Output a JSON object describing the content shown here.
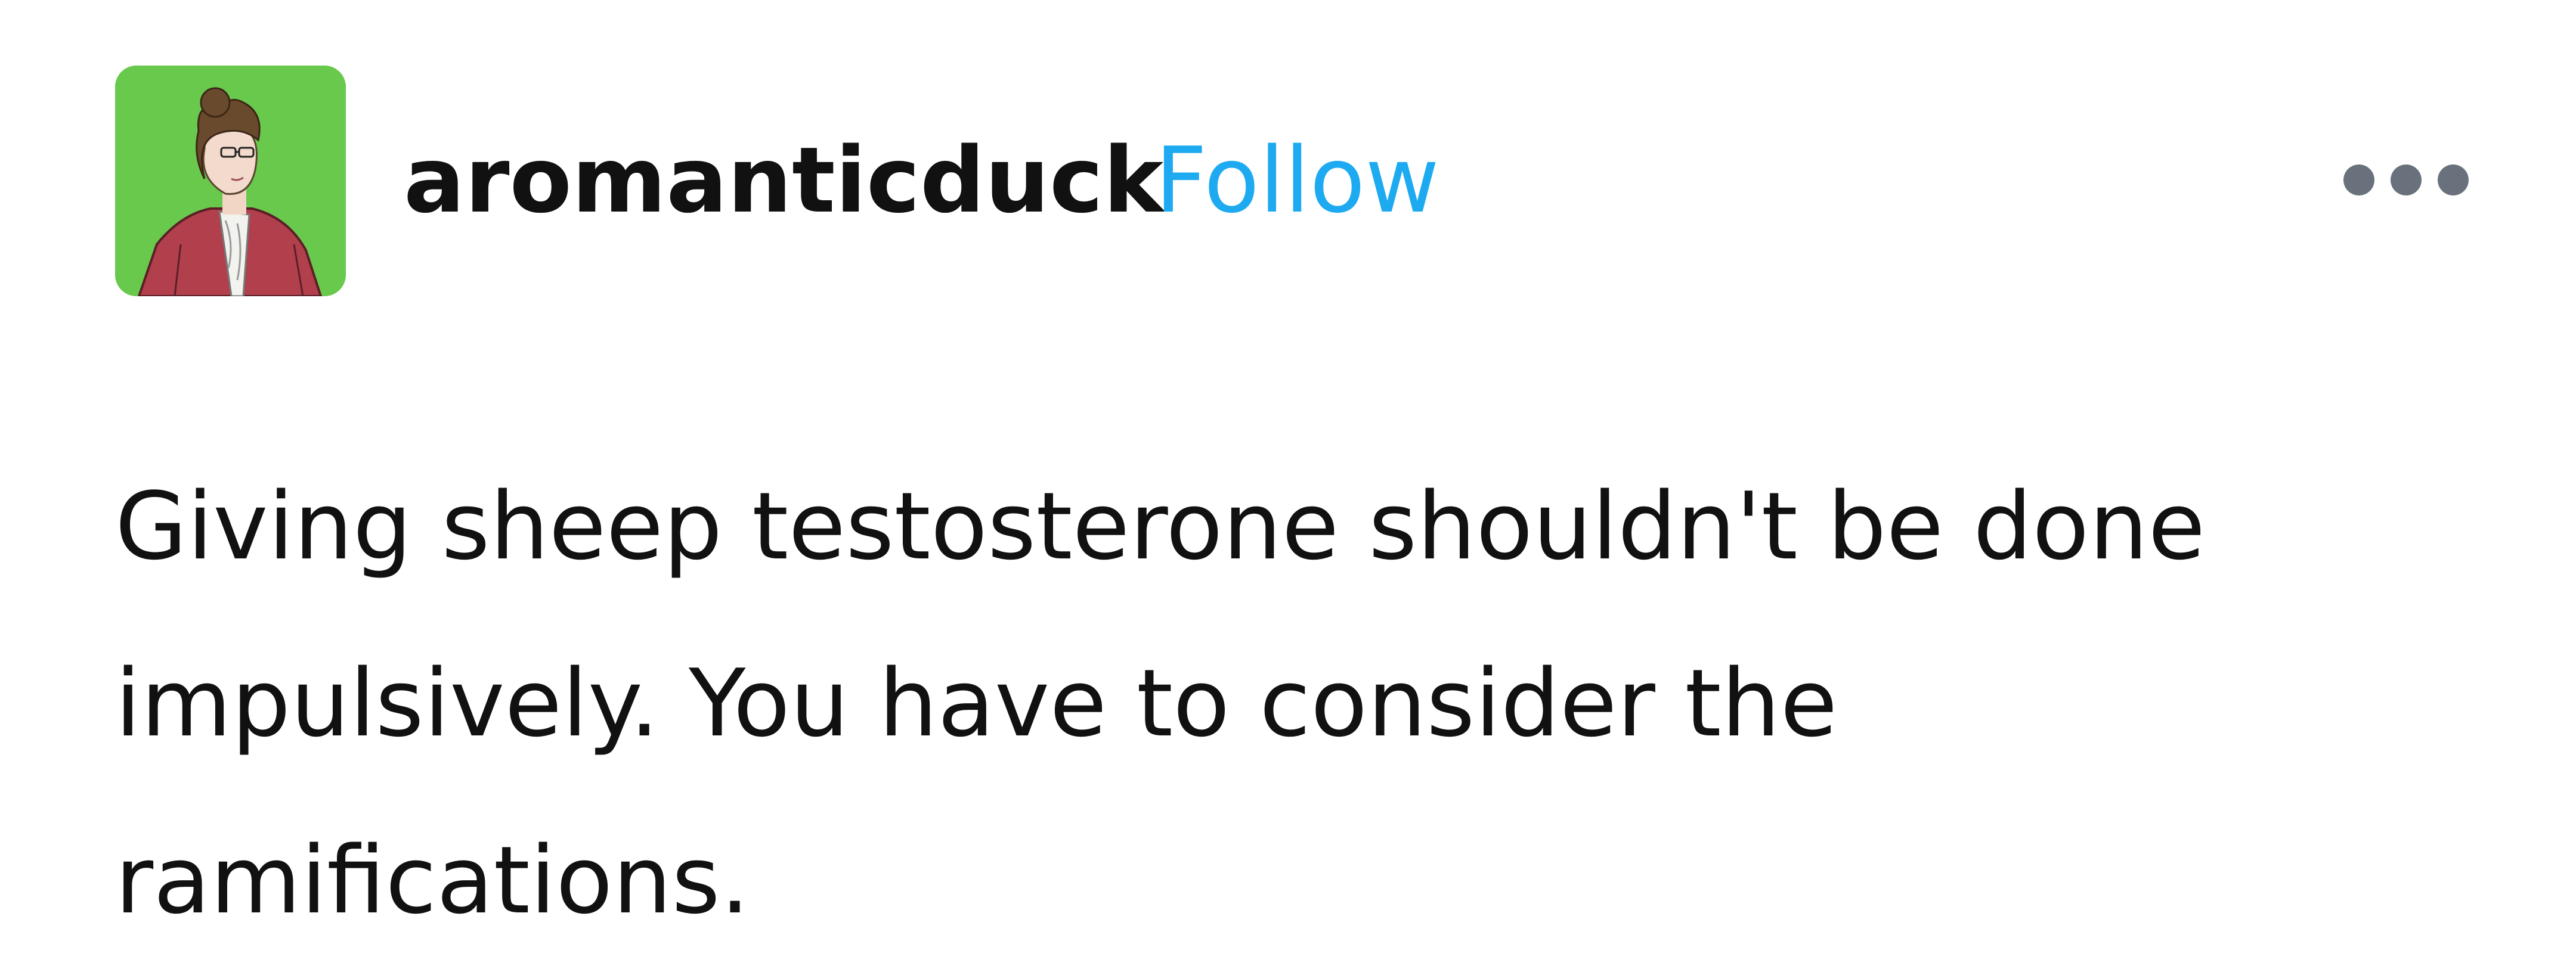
{
  "post": {
    "author": {
      "username": "aromanticduck",
      "avatar_icon": "illustrated-woman-avatar-icon",
      "avatar_background": "#68c94d"
    },
    "follow_label": "Follow",
    "follow_color": "#1eaaf0",
    "more_icon": "more-options-icon",
    "text": "Giving sheep testosterone shouldn't be done impulsively. You have to consider the ramifications."
  }
}
